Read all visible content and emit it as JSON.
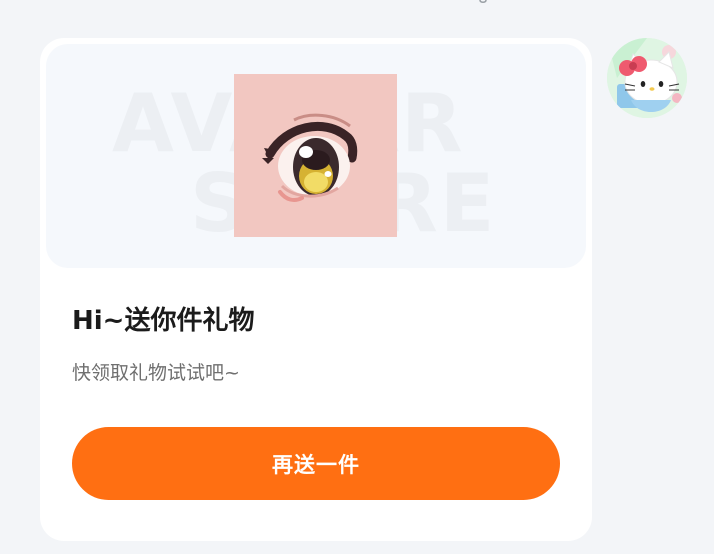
{
  "card": {
    "title": "Hi~送你件礼物",
    "subtitle": "快领取礼物试试吧~",
    "cta_label": "再送一件",
    "watermark_line1": "AVATAR",
    "watermark_line2": "STORE"
  },
  "colors": {
    "background": "#f3f5f8",
    "card": "#ffffff",
    "banner": "#f5f8fc",
    "accent": "#ff6f12",
    "item_background": "#f2c7c1"
  },
  "icons": {
    "item": "anime-eye-icon",
    "avatar": "hello-kitty-avatar"
  }
}
